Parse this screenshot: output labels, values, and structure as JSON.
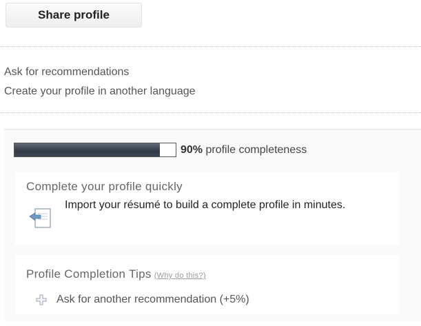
{
  "actions": {
    "share_label": "Share profile"
  },
  "links": {
    "ask_recommendations": "Ask for recommendations",
    "other_language": "Create your profile in another language"
  },
  "completeness": {
    "percent_label": "90%",
    "label": "profile completeness",
    "fill_fraction": 0.9
  },
  "quick": {
    "title": "Complete your profile quickly",
    "import_text": "Import your résumé to build a complete profile in minutes.",
    "icon": "document-import-icon"
  },
  "tips": {
    "title": "Profile Completion Tips",
    "why_link": "(Why do this?)",
    "items": [
      {
        "label": "Ask for another recommendation (+5%)",
        "icon": "plus-icon"
      }
    ]
  },
  "colors": {
    "progress_fill": "#2f3a45",
    "panel_bg": "#fafafa"
  }
}
